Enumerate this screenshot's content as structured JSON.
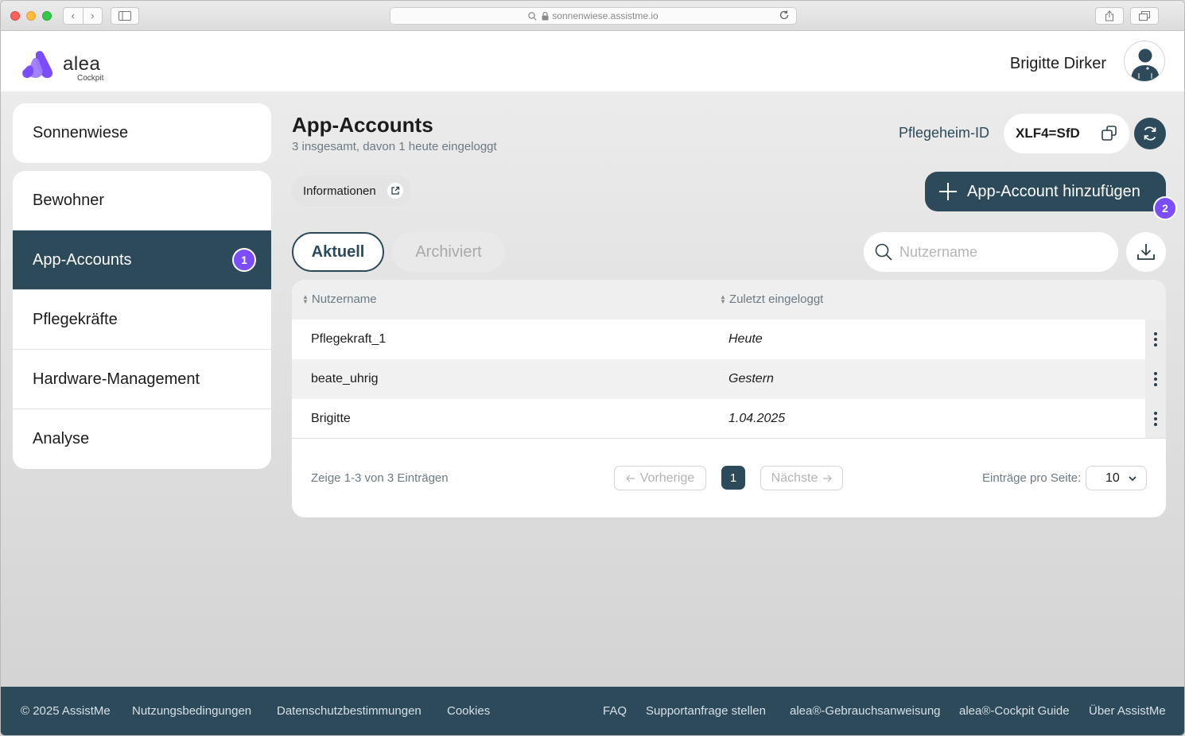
{
  "browser": {
    "url": "sonnenwiese.assistme.io"
  },
  "header": {
    "logo_text": "alea",
    "logo_sub": "Cockpit",
    "user_name": "Brigitte Dirker"
  },
  "sidebar": {
    "facility": "Sonnenwiese",
    "items": [
      {
        "label": "Bewohner"
      },
      {
        "label": "App-Accounts",
        "badge": "1"
      },
      {
        "label": "Pflegekräfte"
      },
      {
        "label": "Hardware-Management"
      },
      {
        "label": "Analyse"
      }
    ]
  },
  "main": {
    "title": "App-Accounts",
    "subtitle": "3 insgesamt, davon 1 heute eingeloggt",
    "pflegeheim_label": "Pflegeheim-ID",
    "pflegeheim_id": "XLF4=SfD",
    "info_chip": "Informationen",
    "add_button": "App-Account hinzufügen",
    "add_badge": "2",
    "tabs": [
      {
        "label": "Aktuell",
        "active": true
      },
      {
        "label": "Archiviert",
        "active": false
      }
    ],
    "search_placeholder": "Nutzername"
  },
  "table": {
    "columns": [
      "Nutzername",
      "Zuletzt eingeloggt"
    ],
    "rows": [
      {
        "username": "Pflegekraft_1",
        "last_login": "Heute"
      },
      {
        "username": "beate_uhrig",
        "last_login": "Gestern"
      },
      {
        "username": "Brigitte",
        "last_login": "1.04.2025"
      }
    ]
  },
  "pagination": {
    "info": "Zeige 1-3 von 3 Einträgen",
    "prev": "Vorherige",
    "next": "Nächste",
    "current_page": "1",
    "per_page_label": "Einträge pro Seite:",
    "per_page_value": "10"
  },
  "footer": {
    "links": [
      "© 2025 AssistMe",
      "Nutzungsbedingungen",
      "Datenschutzbestimmungen",
      "Cookies",
      "FAQ",
      "Supportanfrage stellen",
      "alea®-Gebrauchsanweisung",
      "alea®-Cockpit Guide",
      "Über AssistMe"
    ]
  },
  "colors": {
    "primary": "#2c4a5a",
    "badge": "#7b4dff",
    "logo": "#7b4dff"
  },
  "icons": [
    "search-icon",
    "lock-icon",
    "reload-icon",
    "share-icon",
    "copy-icon",
    "refresh-icon",
    "external-link-icon",
    "plus-icon",
    "download-icon",
    "more-vertical-icon",
    "chevron-down-icon",
    "arrow-left-icon",
    "arrow-right-icon",
    "user-avatar-icon"
  ]
}
